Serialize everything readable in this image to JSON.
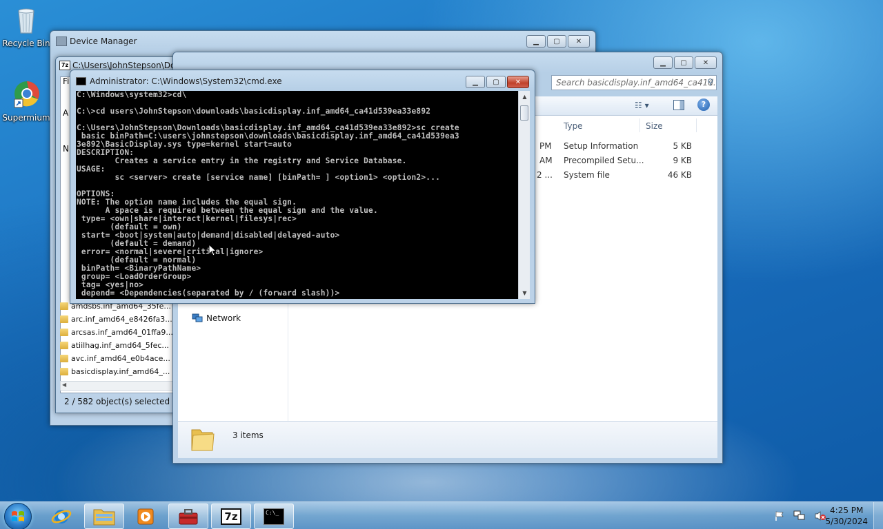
{
  "desktop": {
    "icons": [
      {
        "label": "Recycle Bin",
        "icon": "recycle-bin-icon"
      },
      {
        "label": "Supermium",
        "icon": "supermium-browser-icon"
      }
    ]
  },
  "device_manager": {
    "title": "Device Manager"
  },
  "sevenzip": {
    "title": "C:\\Users\\JohnStepson\\Dow",
    "menu_fragments": [
      "Fi",
      "A",
      "N"
    ],
    "files": [
      "amdsbs.inf_amd64_35fe...",
      "arc.inf_amd64_e8426fa3...",
      "arcsas.inf_amd64_01ffa9...",
      "atiilhag.inf_amd64_5fec...",
      "avc.inf_amd64_e0b4ace...",
      "basicdisplay.inf_amd64_..."
    ],
    "status": "2 / 582 object(s) selected"
  },
  "explorer": {
    "search_placeholder": "Search basicdisplay.inf_amd64_ca41d...",
    "columns": {
      "type": "Type",
      "size": "Size"
    },
    "rows": [
      {
        "date_tail": "PM",
        "type": "Setup Information",
        "size": "5 KB"
      },
      {
        "date_tail": "AM",
        "type": "Precompiled Setu...",
        "size": "9 KB"
      },
      {
        "date_tail": "2 ...",
        "type": "System file",
        "size": "46 KB"
      }
    ],
    "nav_network": "Network",
    "details_count": "3 items"
  },
  "cmd": {
    "title": "Administrator: C:\\Windows\\System32\\cmd.exe",
    "lines": [
      "C:\\Windows\\system32>cd\\",
      "",
      "C:\\>cd users\\JohnStepson\\downloads\\basicdisplay.inf_amd64_ca41d539ea33e892",
      "",
      "C:\\Users\\JohnStepson\\Downloads\\basicdisplay.inf_amd64_ca41d539ea33e892>sc create",
      " basic binPath=C:\\users\\johnstepson\\downloads\\basicdisplay.inf_amd64_ca41d539ea3",
      "3e892\\BasicDisplay.sys type=kernel start=auto",
      "DESCRIPTION:",
      "        Creates a service entry in the registry and Service Database.",
      "USAGE:",
      "        sc <server> create [service name] [binPath= ] <option1> <option2>...",
      "",
      "OPTIONS:",
      "NOTE: The option name includes the equal sign.",
      "      A space is required between the equal sign and the value.",
      " type= <own|share|interact|kernel|filesys|rec>",
      "       (default = own)",
      " start= <boot|system|auto|demand|disabled|delayed-auto>",
      "       (default = demand)",
      " error= <normal|severe|critical|ignore>",
      "       (default = normal)",
      " binPath= <BinaryPathName>",
      " group= <LoadOrderGroup>",
      " tag= <yes|no>",
      " depend= <Dependencies(separated by / (forward slash))>"
    ]
  },
  "taskbar": {
    "pinned": [
      {
        "name": "internet-explorer-icon"
      },
      {
        "name": "windows-explorer-icon"
      },
      {
        "name": "media-player-icon"
      },
      {
        "name": "toolbox-app-icon"
      },
      {
        "name": "7zip-icon",
        "label": "7z"
      },
      {
        "name": "cmd-icon",
        "label": "C:\\_"
      }
    ],
    "clock": {
      "time": "4:25 PM",
      "date": "5/30/2024"
    }
  }
}
